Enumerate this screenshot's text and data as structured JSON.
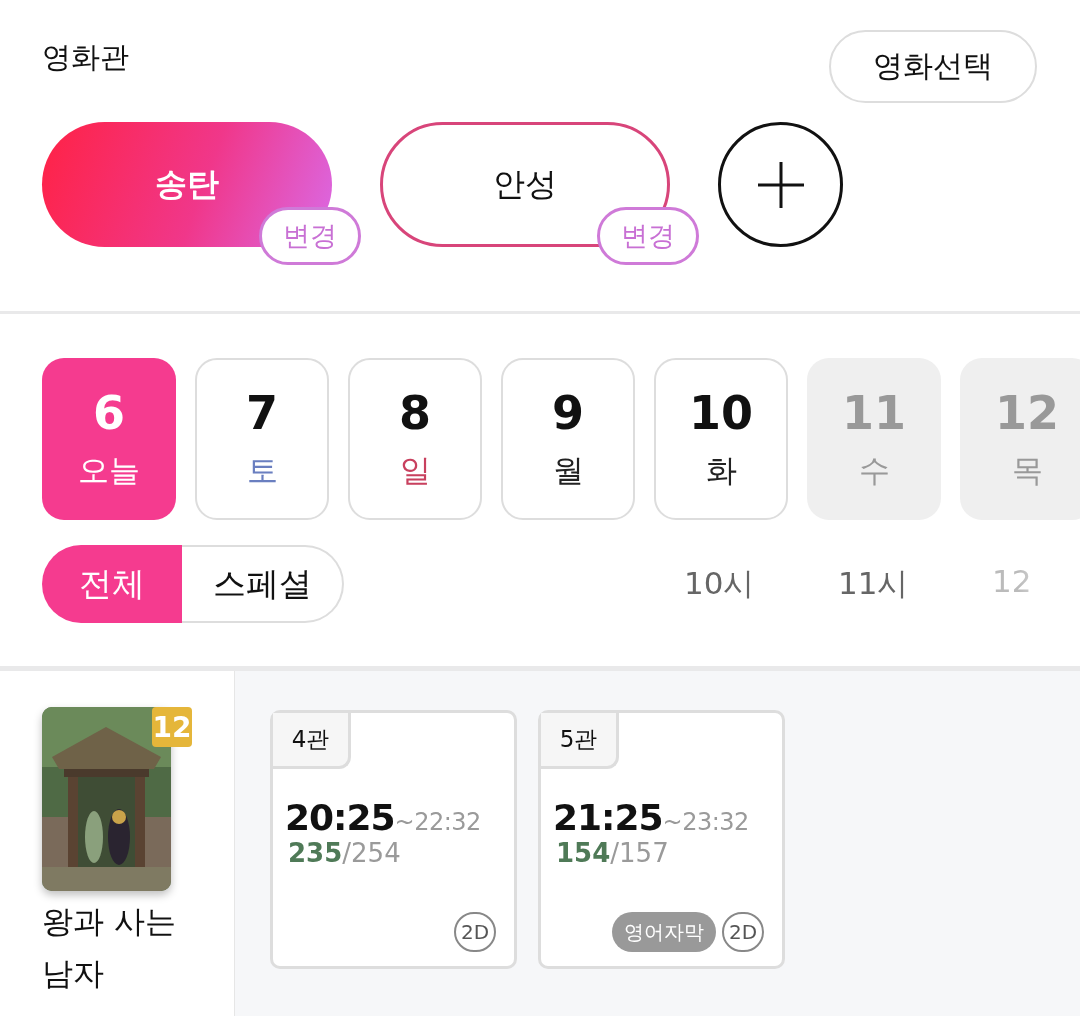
{
  "header": {
    "title": "영화관",
    "select_button": "영화선택"
  },
  "theaters": [
    {
      "name": "송탄",
      "change": "변경",
      "selected": true
    },
    {
      "name": "안성",
      "change": "변경",
      "selected": false
    }
  ],
  "dates": [
    {
      "day": "6",
      "weekday": "오늘",
      "kind": "today",
      "selected": true,
      "disabled": false
    },
    {
      "day": "7",
      "weekday": "토",
      "kind": "saturday",
      "selected": false,
      "disabled": false
    },
    {
      "day": "8",
      "weekday": "일",
      "kind": "sunday",
      "selected": false,
      "disabled": false
    },
    {
      "day": "9",
      "weekday": "월",
      "kind": "weekday",
      "selected": false,
      "disabled": false
    },
    {
      "day": "10",
      "weekday": "화",
      "kind": "weekday",
      "selected": false,
      "disabled": false
    },
    {
      "day": "11",
      "weekday": "수",
      "kind": "weekday",
      "selected": false,
      "disabled": true
    },
    {
      "day": "12",
      "weekday": "목",
      "kind": "weekday",
      "selected": false,
      "disabled": true
    }
  ],
  "filters": [
    {
      "label": "전체",
      "selected": true
    },
    {
      "label": "스페셜",
      "selected": false
    }
  ],
  "hours": [
    {
      "label": "10시",
      "faded": false
    },
    {
      "label": "11시",
      "faded": false
    },
    {
      "label": "12",
      "faded": true
    }
  ],
  "movies": [
    {
      "poster": {
        "kind": "picture"
      },
      "rating": "12",
      "title": "왕과 사는 남자",
      "showtimes": [
        {
          "hall": "4관",
          "start": "20:25",
          "end": "~22:32",
          "available": "235",
          "total": "/254",
          "tags": [
            {
              "label": "2D",
              "kind": "format"
            }
          ]
        },
        {
          "hall": "5관",
          "start": "21:25",
          "end": "~23:32",
          "available": "154",
          "total": "/157",
          "tags": [
            {
              "label": "영어자막",
              "kind": "subtitle"
            },
            {
              "label": "2D",
              "kind": "format"
            }
          ]
        }
      ]
    }
  ]
}
